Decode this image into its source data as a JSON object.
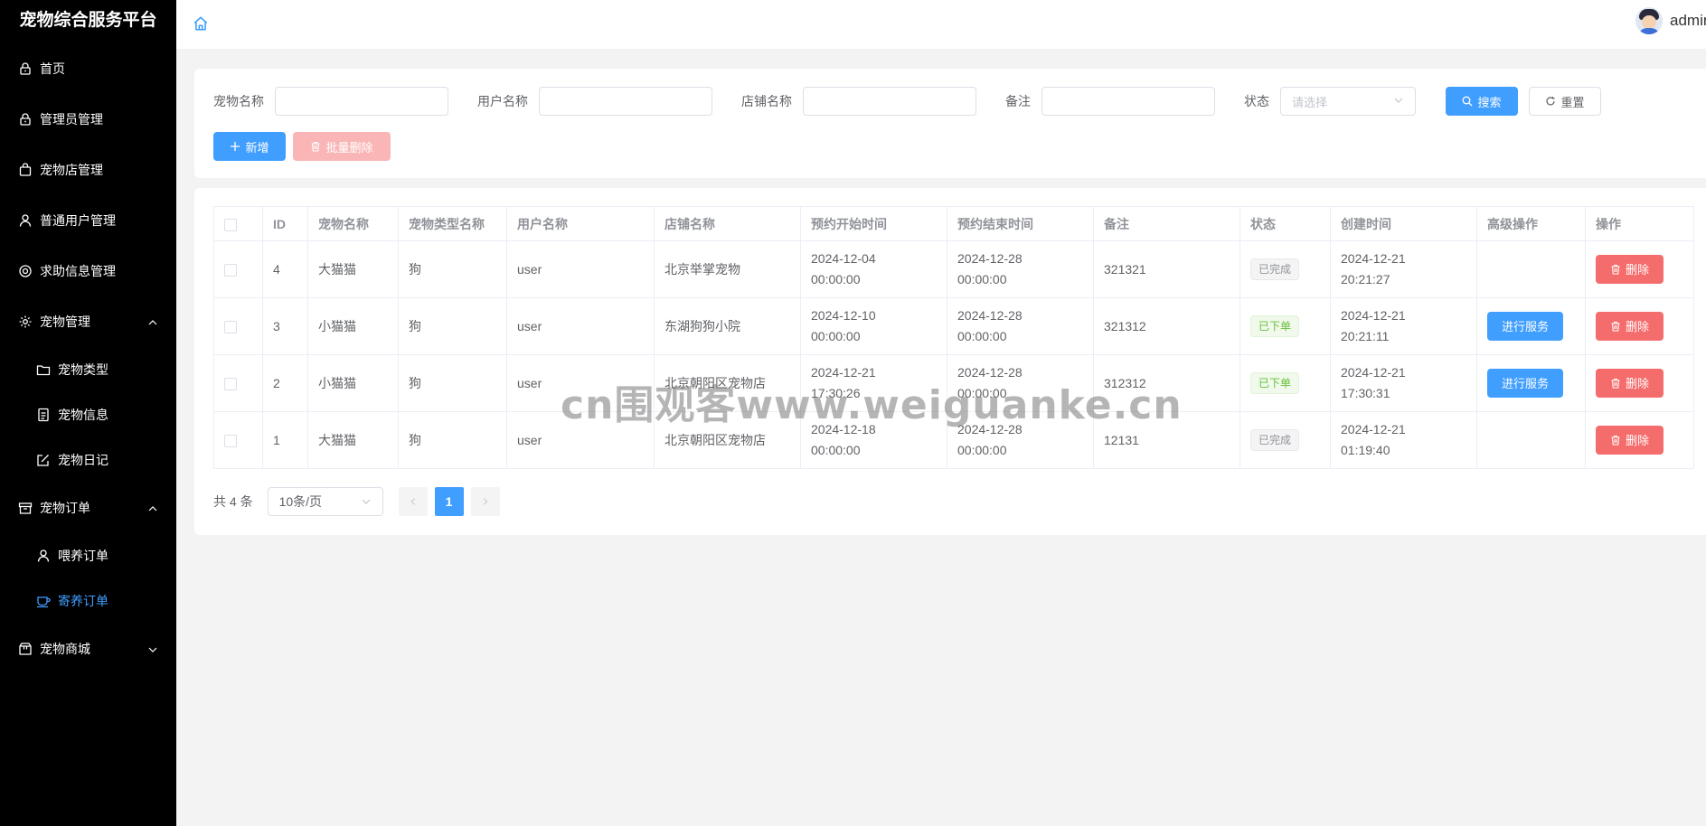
{
  "app": {
    "title": "宠物综合服务平台",
    "username": "admin"
  },
  "sidebar": {
    "items": [
      {
        "label": "首页",
        "icon": "lock-icon"
      },
      {
        "label": "管理员管理",
        "icon": "lock-icon"
      },
      {
        "label": "宠物店管理",
        "icon": "bag-icon"
      },
      {
        "label": "普通用户管理",
        "icon": "user-icon"
      },
      {
        "label": "求助信息管理",
        "icon": "lifebuoy-icon"
      },
      {
        "label": "宠物管理",
        "icon": "gear-icon",
        "expanded": true
      },
      {
        "label": "宠物类型",
        "icon": "folder-icon",
        "sub": true
      },
      {
        "label": "宠物信息",
        "icon": "document-icon",
        "sub": true
      },
      {
        "label": "宠物日记",
        "icon": "edit-icon",
        "sub": true
      },
      {
        "label": "宠物订单",
        "icon": "box-icon",
        "expanded": true
      },
      {
        "label": "喂养订单",
        "icon": "user-icon",
        "sub": true
      },
      {
        "label": "寄养订单",
        "icon": "cup-icon",
        "sub": true,
        "active": true
      },
      {
        "label": "宠物商城",
        "icon": "shop-icon",
        "expanded": false
      }
    ]
  },
  "search": {
    "pet_name_label": "宠物名称",
    "user_name_label": "用户名称",
    "shop_name_label": "店铺名称",
    "remark_label": "备注",
    "status_label": "状态",
    "status_placeholder": "请选择",
    "search_button": "搜索",
    "reset_button": "重置",
    "add_button": "新增",
    "batch_delete_button": "批量删除"
  },
  "table": {
    "columns": [
      "ID",
      "宠物名称",
      "宠物类型名称",
      "用户名称",
      "店铺名称",
      "预约开始时间",
      "预约结束时间",
      "备注",
      "状态",
      "创建时间",
      "高级操作",
      "操作"
    ],
    "rows": [
      {
        "id": "4",
        "pet": "大猫猫",
        "type": "狗",
        "user": "user",
        "shop": "北京举掌宠物",
        "start_date": "2024-12-04",
        "start_time": "00:00:00",
        "end_date": "2024-12-28",
        "end_time": "00:00:00",
        "remark": "321321",
        "status": "已完成",
        "created_date": "2024-12-21",
        "created_time": "20:21:27",
        "service": ""
      },
      {
        "id": "3",
        "pet": "小猫猫",
        "type": "狗",
        "user": "user",
        "shop": "东湖狗狗小院",
        "start_date": "2024-12-10",
        "start_time": "00:00:00",
        "end_date": "2024-12-28",
        "end_time": "00:00:00",
        "remark": "321312",
        "status": "已下单",
        "created_date": "2024-12-21",
        "created_time": "20:21:11",
        "service": "进行服务"
      },
      {
        "id": "2",
        "pet": "小猫猫",
        "type": "狗",
        "user": "user",
        "shop": "北京朝阳区宠物店",
        "start_date": "2024-12-21",
        "start_time": "17:30:26",
        "end_date": "2024-12-28",
        "end_time": "00:00:00",
        "remark": "312312",
        "status": "已下单",
        "created_date": "2024-12-21",
        "created_time": "17:30:31",
        "service": "进行服务"
      },
      {
        "id": "1",
        "pet": "大猫猫",
        "type": "狗",
        "user": "user",
        "shop": "北京朝阳区宠物店",
        "start_date": "2024-12-18",
        "start_time": "00:00:00",
        "end_date": "2024-12-28",
        "end_time": "00:00:00",
        "remark": "12131",
        "status": "已完成",
        "created_date": "2024-12-21",
        "created_time": "01:19:40",
        "service": ""
      }
    ],
    "delete_label": "删除"
  },
  "pagination": {
    "total": "共 4 条",
    "page_size": "10条/页",
    "current_page": "1"
  },
  "watermark": "cn围观客www.weiguanke.cn",
  "colors": {
    "primary": "#409eff",
    "danger": "#f56c6c",
    "success": "#67c23a",
    "sidebar_bg": "#000000"
  }
}
